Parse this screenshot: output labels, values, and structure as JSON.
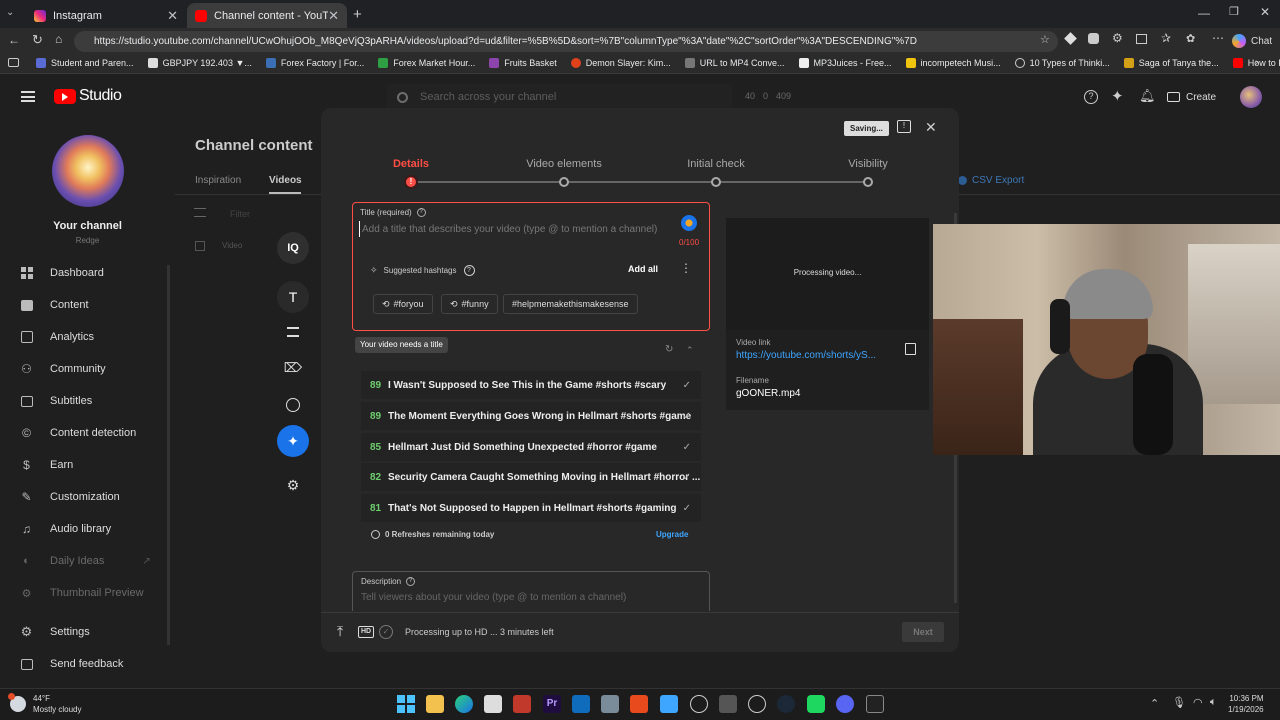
{
  "browser": {
    "tabs": [
      {
        "title": "Instagram",
        "close": "✕"
      },
      {
        "title": "Channel content - YouTube Studio",
        "close": "✕"
      }
    ],
    "new_tab": "+",
    "url": "https://studio.youtube.com/channel/UCwOhujOOb_M8QeVjQ3pARHA/videos/upload?d=ud&filter=%5B%5D&sort=%7B\"columnType\"%3A\"date\"%2C\"sortOrder\"%3A\"DESCENDING\"%7D",
    "bookmarks": [
      "Student and Paren...",
      "GBPJPY 192.403 ▼...",
      "Forex Factory | For...",
      "Forex Market Hour...",
      "Fruits Basket",
      "Demon Slayer: Kim...",
      "URL to MP4 Conve...",
      "MP3Juices - Free...",
      "incompetech Musi...",
      "10 Types of Thinki...",
      "Saga of Tanya the...",
      "How to Fix Screen..."
    ],
    "chat": "Chat"
  },
  "studio": {
    "logo": "Studio",
    "search_placeholder": "Search across your channel",
    "counts": [
      "40",
      "0",
      "409"
    ],
    "create": "Create",
    "channel_title": "Channel content",
    "page_tabs": [
      "Inspiration",
      "Videos"
    ],
    "filter": "Filter",
    "video_col": "Video",
    "csv": "CSV Export",
    "your_channel": "Your channel",
    "channel_name": "Redge",
    "nav": [
      "Dashboard",
      "Content",
      "Analytics",
      "Community",
      "Subtitles",
      "Content detection",
      "Earn",
      "Customization",
      "Audio library",
      "Daily Ideas",
      "Thumbnail Preview"
    ],
    "settings": "Settings",
    "feedback": "Send feedback"
  },
  "modal": {
    "saving": "Saving...",
    "steps": [
      "Details",
      "Video elements",
      "Initial check",
      "Visibility"
    ],
    "title_label": "Title (required)",
    "title_placeholder": "Add a title that describes your video (type @ to mention a channel)",
    "char_count": "0/100",
    "suggested_hashtags": "Suggested hashtags",
    "add_all": "Add all",
    "hashtags": [
      "#foryou",
      "#funny",
      "#helpmemakethismakesense"
    ],
    "tooltip": "Your video needs a title",
    "suggestions": [
      {
        "score": "89",
        "text": "I Wasn't Supposed to See This in the Game #shorts #scary"
      },
      {
        "score": "89",
        "text": "The Moment Everything Goes Wrong in Hellmart #shorts #game"
      },
      {
        "score": "85",
        "text": "Hellmart Just Did Something Unexpected #horror #game"
      },
      {
        "score": "82",
        "text": "Security Camera Caught Something Moving in Hellmart #horror ..."
      },
      {
        "score": "81",
        "text": "That's Not Supposed to Happen in Hellmart #shorts #gaming"
      }
    ],
    "refreshes": "0 Refreshes remaining today",
    "upgrade": "Upgrade",
    "description_label": "Description",
    "description_placeholder": "Tell viewers about your video (type @ to mention a channel)",
    "processing_preview": "Processing video...",
    "video_link_label": "Video link",
    "video_link": "https://youtube.com/shorts/yS...",
    "filename_label": "Filename",
    "filename": "gOONER.mp4",
    "hd": "HD",
    "status": "Processing up to HD ... 3 minutes left",
    "next": "Next"
  },
  "taskbar": {
    "weather_temp": "44°F",
    "weather_desc": "Mostly cloudy",
    "time": "10:36 PM",
    "date": "1/19/2026"
  },
  "colors": {
    "accent_red": "#ff4e45",
    "link_blue": "#3ea6ff",
    "score_green": "#6fcf6f"
  }
}
